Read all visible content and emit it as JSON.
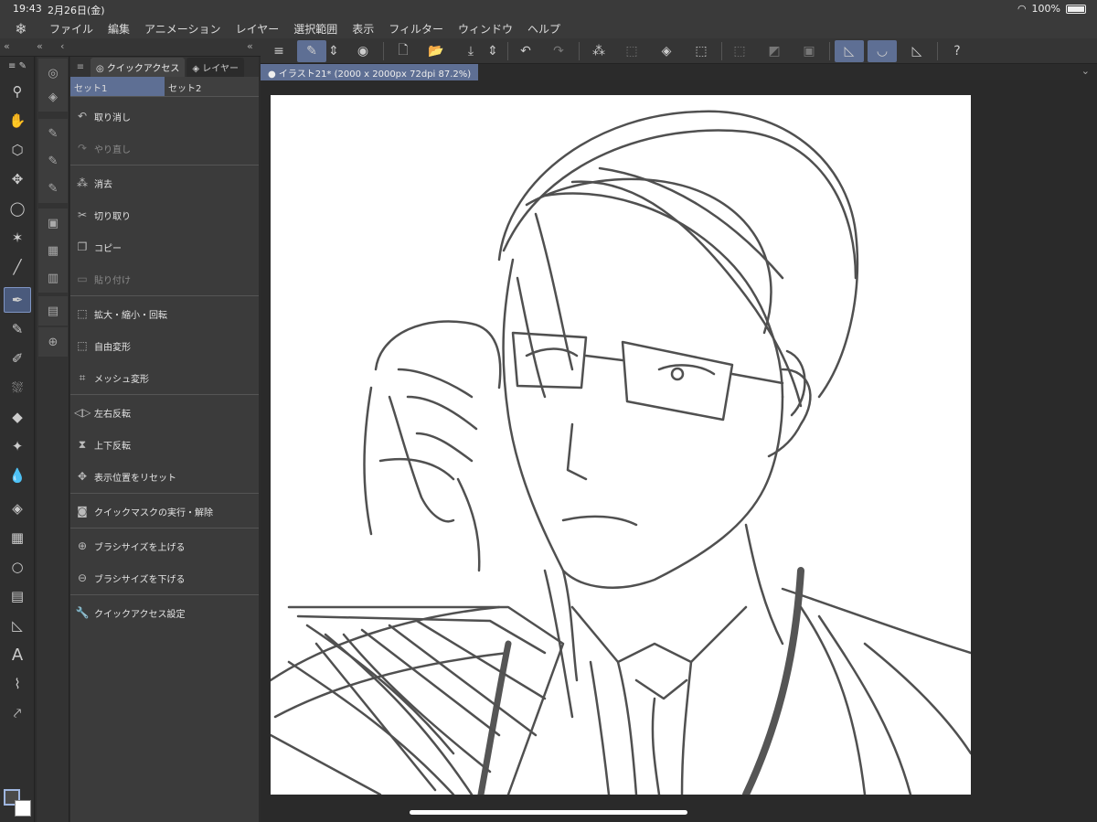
{
  "status": {
    "time": "19:43",
    "date": "2月26日(金)",
    "battery": "100%"
  },
  "menu": [
    "ファイル",
    "編集",
    "アニメーション",
    "レイヤー",
    "選択範囲",
    "表示",
    "フィルター",
    "ウィンドウ",
    "ヘルプ"
  ],
  "panel": {
    "tabs": [
      "クイックアクセス",
      "レイヤー"
    ],
    "sets": [
      "セット1",
      "セット2"
    ],
    "items": [
      {
        "label": "取り消し",
        "icon": "undo-icon",
        "disabled": false
      },
      {
        "label": "やり直し",
        "icon": "redo-icon",
        "disabled": true
      },
      {
        "label": "消去",
        "icon": "clear-icon",
        "disabled": false
      },
      {
        "label": "切り取り",
        "icon": "scissors-icon",
        "disabled": false
      },
      {
        "label": "コピー",
        "icon": "copy-icon",
        "disabled": false
      },
      {
        "label": "貼り付け",
        "icon": "paste-icon",
        "disabled": true
      },
      {
        "label": "拡大・縮小・回転",
        "icon": "scale-icon",
        "disabled": false
      },
      {
        "label": "自由変形",
        "icon": "free-transform-icon",
        "disabled": false
      },
      {
        "label": "メッシュ変形",
        "icon": "mesh-icon",
        "disabled": false
      },
      {
        "label": "左右反転",
        "icon": "flip-h-icon",
        "disabled": false
      },
      {
        "label": "上下反転",
        "icon": "flip-v-icon",
        "disabled": false
      },
      {
        "label": "表示位置をリセット",
        "icon": "reset-view-icon",
        "disabled": false
      },
      {
        "label": "クイックマスクの実行・解除",
        "icon": "quick-mask-icon",
        "disabled": false
      },
      {
        "label": "ブラシサイズを上げる",
        "icon": "brush-up-icon",
        "disabled": false
      },
      {
        "label": "ブラシサイズを下げる",
        "icon": "brush-down-icon",
        "disabled": false
      },
      {
        "label": "クイックアクセス設定",
        "icon": "wrench-icon",
        "disabled": false
      }
    ]
  },
  "document": {
    "tab_label": "イラスト21* (2000 x 2000px 72dpi 87.2%)"
  },
  "colors": {
    "accent": "#5e6f94",
    "canvas": "#ffffff",
    "stroke": "#505050"
  }
}
